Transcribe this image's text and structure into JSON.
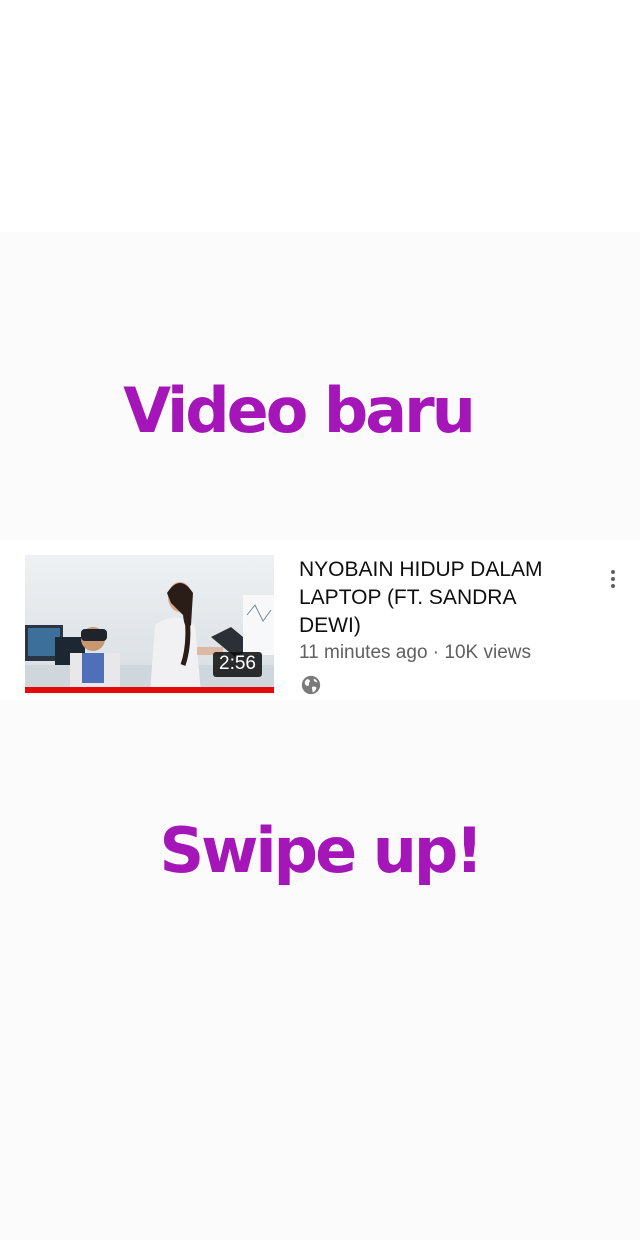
{
  "banner": {
    "top_text": "Video baru",
    "bottom_text": "Swipe up!"
  },
  "video": {
    "title": "NYOBAIN HIDUP DALAM LAPTOP (FT. SANDRA DEWI)",
    "duration": "2:56",
    "age": "11 minutes ago",
    "separator": "·",
    "views": "10K views",
    "visibility_icon": "globe-icon",
    "menu_icon": "more-vert-icon",
    "watched_progress": 1.0
  },
  "colors": {
    "headline": "#a416b8",
    "progress": "#e20a0a",
    "meta_text": "#606060"
  }
}
